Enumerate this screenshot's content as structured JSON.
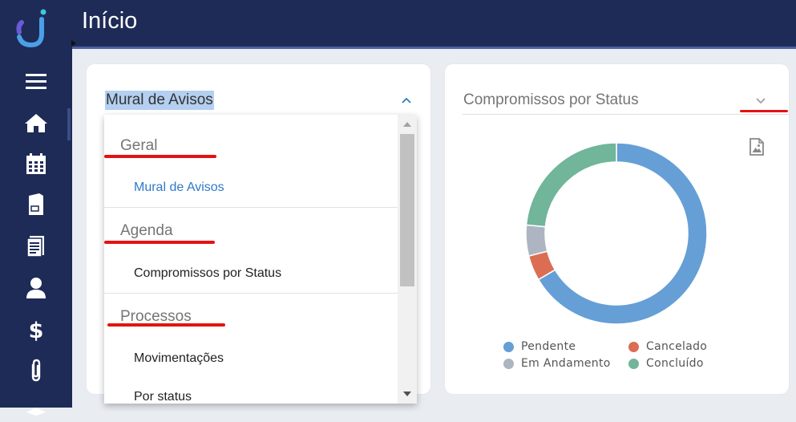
{
  "header": {
    "title": "Início"
  },
  "sidebar": {
    "items": [
      {
        "icon": "menu-icon"
      },
      {
        "icon": "home-icon"
      },
      {
        "icon": "calendar-icon"
      },
      {
        "icon": "folder-icon"
      },
      {
        "icon": "document-icon"
      },
      {
        "icon": "user-icon"
      },
      {
        "icon": "dollar-icon"
      },
      {
        "icon": "paperclip-icon"
      },
      {
        "icon": "box-icon"
      }
    ]
  },
  "widget1": {
    "selected": "Mural de Avisos",
    "dropdown": {
      "groups": [
        {
          "label": "Geral",
          "options": [
            "Mural de Avisos"
          ]
        },
        {
          "label": "Agenda",
          "options": [
            "Compromissos por Status"
          ]
        },
        {
          "label": "Processos",
          "options": [
            "Movimentações",
            "Por status"
          ]
        }
      ]
    }
  },
  "widget2": {
    "selected": "Compromissos por Status"
  },
  "colors": {
    "sidebar": "#1e2b57",
    "pendente": "#659fd6",
    "cancelado": "#db6e52",
    "em_andamento": "#adb4c2",
    "concluido": "#71b59a",
    "annotation": "#e31313"
  },
  "chart_data": {
    "type": "pie",
    "donut": true,
    "series": [
      {
        "name": "Pendente",
        "value": 66.5
      },
      {
        "name": "Cancelado",
        "value": 4.5
      },
      {
        "name": "Em Andamento",
        "value": 5.5
      },
      {
        "name": "Concluído",
        "value": 23.5
      }
    ],
    "legend_position": "bottom"
  }
}
